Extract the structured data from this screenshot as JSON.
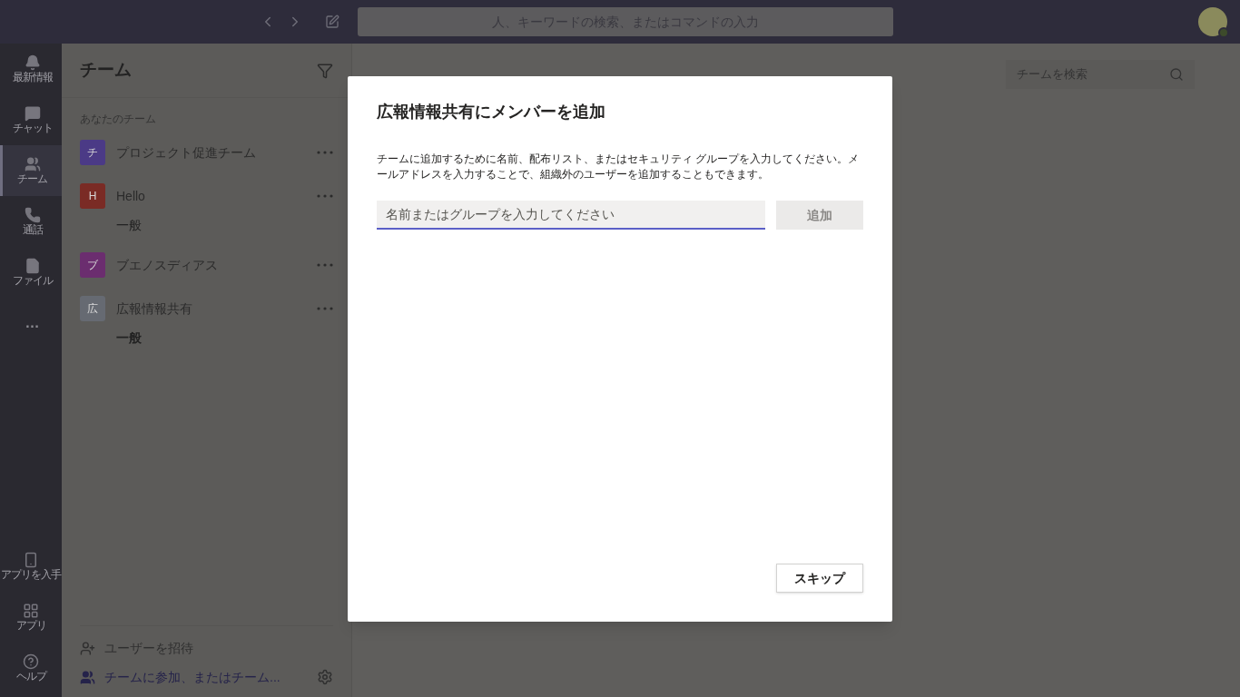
{
  "top_bar": {
    "search_placeholder": "人、キーワードの検索、またはコマンドの入力"
  },
  "rail": {
    "items": [
      {
        "kind": "bell",
        "label": "最新情報",
        "selected": false
      },
      {
        "kind": "chat",
        "label": "チャット",
        "selected": false
      },
      {
        "kind": "teams",
        "label": "チーム",
        "selected": true
      },
      {
        "kind": "phone",
        "label": "通話",
        "selected": false
      },
      {
        "kind": "file",
        "label": "ファイル",
        "selected": false
      },
      {
        "kind": "more",
        "label": "…",
        "selected": false
      }
    ],
    "bottom_items": [
      {
        "kind": "mobile",
        "label": "アプリを入手"
      },
      {
        "kind": "apps",
        "label": "アプリ"
      },
      {
        "kind": "help",
        "label": "ヘルプ"
      }
    ]
  },
  "sidebar": {
    "title": "チーム",
    "section": "あなたのチーム",
    "teams": [
      {
        "initial": "チ",
        "name": "プロジェクト促進チーム",
        "color": "#4b3a86"
      },
      {
        "initial": "H",
        "name": "Hello",
        "color": "#7a2b25",
        "children": [
          {
            "name": "一般",
            "selected": false
          }
        ]
      },
      {
        "initial": "ブ",
        "name": "ブエノスディアス",
        "color": "#6b2d6f"
      },
      {
        "initial": "広",
        "name": "広報情報共有",
        "color": "#666a72",
        "children": [
          {
            "name": "一般",
            "selected": true
          }
        ]
      }
    ],
    "invite": "ユーザーを招待",
    "join": "チームに参加、またはチーム..."
  },
  "main": {
    "search_placeholder": "チームを検索"
  },
  "dialog": {
    "title": "広報情報共有にメンバーを追加",
    "description": "チームに追加するために名前、配布リスト、またはセキュリティ グループを入力してください。メールアドレスを入力することで、組織外のユーザーを追加することもできます。",
    "input_placeholder": "名前またはグループを入力してください",
    "add_button": {
      "label": "追加",
      "disabled": true
    },
    "skip_button": "スキップ"
  }
}
